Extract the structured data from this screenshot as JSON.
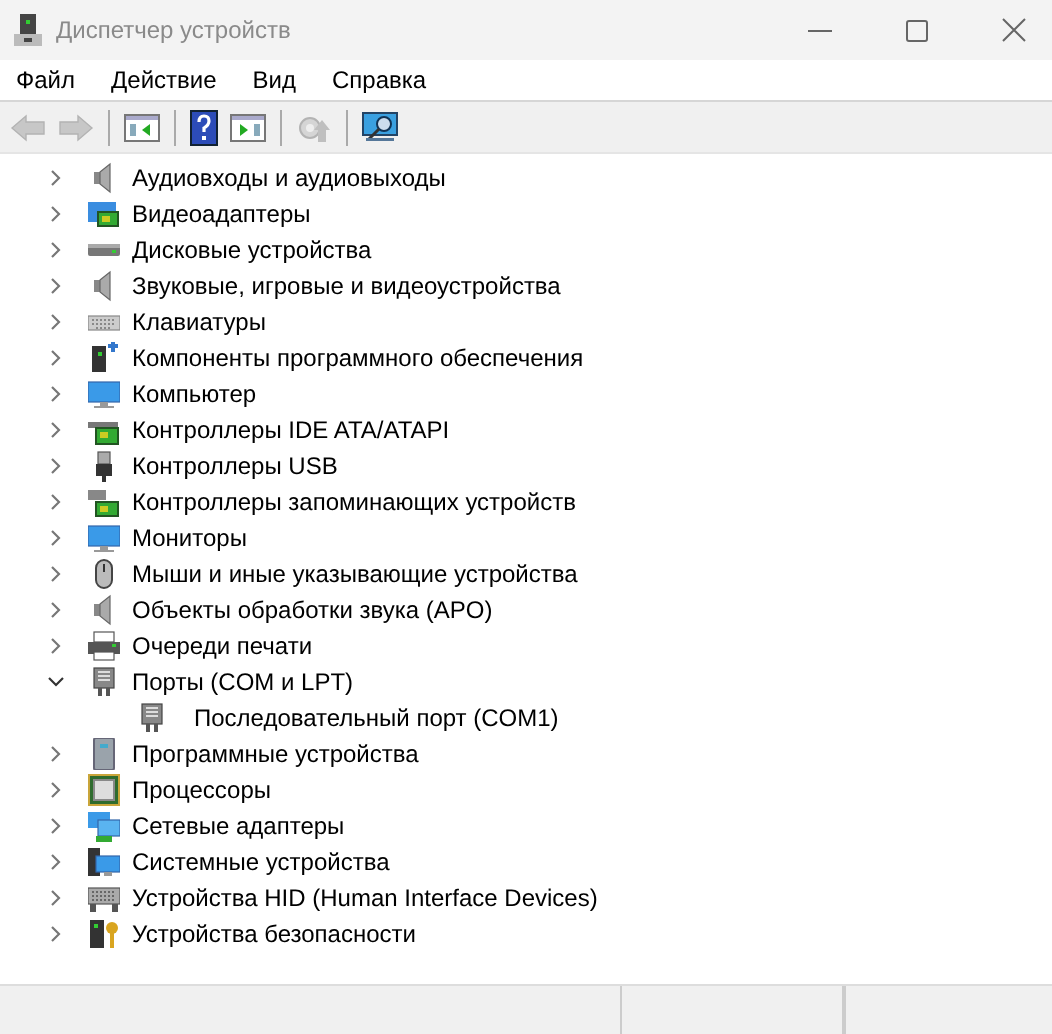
{
  "window": {
    "title": "Диспетчер устройств"
  },
  "menu": [
    "Файл",
    "Действие",
    "Вид",
    "Справка"
  ],
  "toolbar": [
    {
      "kind": "back",
      "disabled": true
    },
    {
      "kind": "forward",
      "disabled": true
    },
    {
      "kind": "separator"
    },
    {
      "kind": "tree-panel",
      "disabled": false
    },
    {
      "kind": "separator"
    },
    {
      "kind": "help",
      "disabled": false
    },
    {
      "kind": "action-panel",
      "disabled": false
    },
    {
      "kind": "separator"
    },
    {
      "kind": "update",
      "disabled": true
    },
    {
      "kind": "separator"
    },
    {
      "kind": "scan",
      "disabled": false
    }
  ],
  "tree": [
    {
      "label": "Аудиовходы и аудиовыходы",
      "kind": "speaker",
      "expanded": false
    },
    {
      "label": "Видеоадаптеры",
      "kind": "display",
      "expanded": false
    },
    {
      "label": "Дисковые устройства",
      "kind": "drive",
      "expanded": false
    },
    {
      "label": "Звуковые, игровые и видеоустройства",
      "kind": "speaker",
      "expanded": false
    },
    {
      "label": "Клавиатуры",
      "kind": "keyboard",
      "expanded": false
    },
    {
      "label": "Компоненты программного обеспечения",
      "kind": "component",
      "expanded": false
    },
    {
      "label": "Компьютер",
      "kind": "monitor",
      "expanded": false
    },
    {
      "label": "Контроллеры IDE ATA/ATAPI",
      "kind": "card",
      "expanded": false
    },
    {
      "label": "Контроллеры USB",
      "kind": "usb",
      "expanded": false
    },
    {
      "label": "Контроллеры запоминающих устройств",
      "kind": "storage",
      "expanded": false
    },
    {
      "label": "Мониторы",
      "kind": "monitor",
      "expanded": false
    },
    {
      "label": "Мыши и иные указывающие устройства",
      "kind": "mouse",
      "expanded": false
    },
    {
      "label": "Объекты обработки звука (APO)",
      "kind": "speaker",
      "expanded": false
    },
    {
      "label": "Очереди печати",
      "kind": "printer",
      "expanded": false
    },
    {
      "label": "Порты (COM и LPT)",
      "kind": "port",
      "expanded": true,
      "children": [
        {
          "label": "Последовательный порт (COM1)",
          "kind": "port"
        }
      ]
    },
    {
      "label": "Программные устройства",
      "kind": "tower",
      "expanded": false
    },
    {
      "label": "Процессоры",
      "kind": "cpu",
      "expanded": false
    },
    {
      "label": "Сетевые адаптеры",
      "kind": "network",
      "expanded": false
    },
    {
      "label": "Системные устройства",
      "kind": "system",
      "expanded": false
    },
    {
      "label": "Устройства HID (Human Interface Devices)",
      "kind": "hid",
      "expanded": false
    },
    {
      "label": "Устройства безопасности",
      "kind": "security",
      "expanded": false
    }
  ]
}
